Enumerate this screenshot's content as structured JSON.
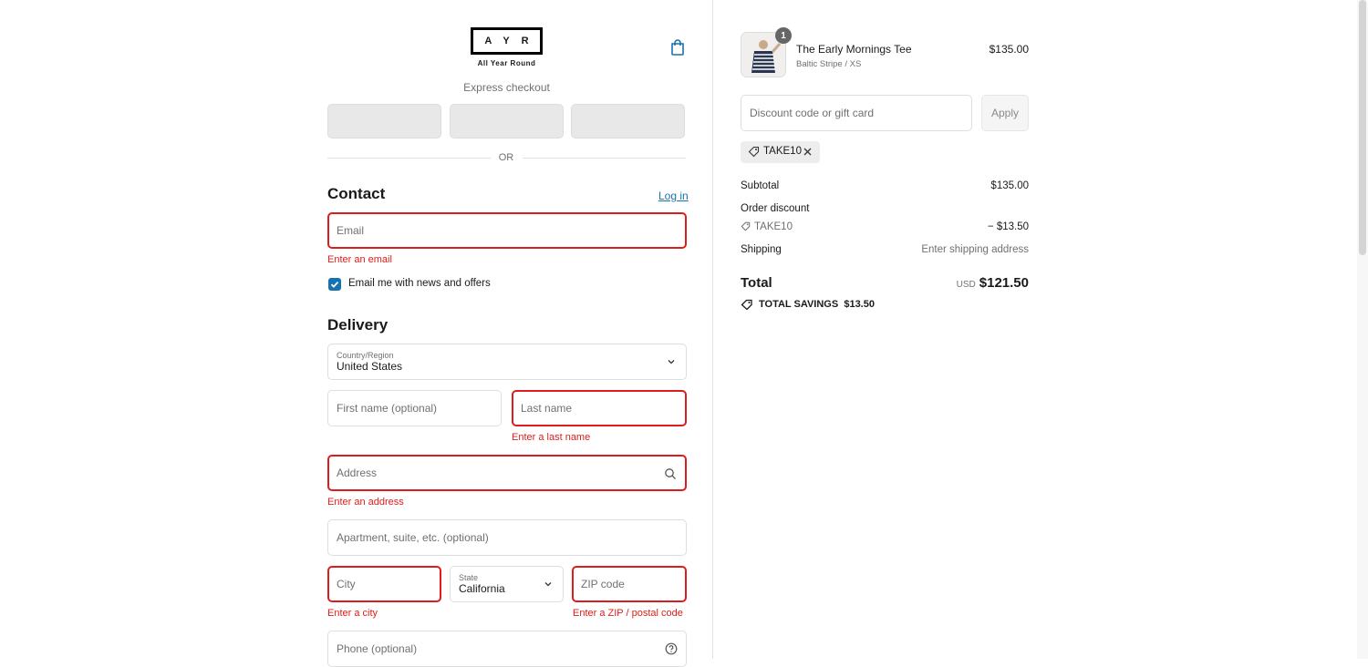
{
  "brand": {
    "logo_text": "AYR",
    "tagline": "All Year Round"
  },
  "express": {
    "label": "Express checkout",
    "or": "OR"
  },
  "contact": {
    "title": "Contact",
    "login": "Log in",
    "email_placeholder": "Email",
    "email_error": "Enter an email",
    "newsletter_label": "Email me with news and offers",
    "newsletter_checked": true
  },
  "delivery": {
    "title": "Delivery",
    "country_label": "Country/Region",
    "country_value": "United States",
    "first_name_placeholder": "First name (optional)",
    "last_name_placeholder": "Last name",
    "last_name_error": "Enter a last name",
    "address_placeholder": "Address",
    "address_error": "Enter an address",
    "apartment_placeholder": "Apartment, suite, etc. (optional)",
    "city_placeholder": "City",
    "city_error": "Enter a city",
    "state_label": "State",
    "state_value": "California",
    "zip_placeholder": "ZIP code",
    "zip_error": "Enter a ZIP / postal code",
    "phone_placeholder": "Phone (optional)"
  },
  "summary": {
    "product": {
      "name": "The Early Mornings Tee",
      "variant": "Baltic Stripe / XS",
      "price": "$135.00",
      "quantity": "1"
    },
    "discount_placeholder": "Discount code or gift card",
    "apply_label": "Apply",
    "applied_code": "TAKE10",
    "subtotal_label": "Subtotal",
    "subtotal_value": "$135.00",
    "order_discount_label": "Order discount",
    "discount_code": "TAKE10",
    "discount_value": "− $13.50",
    "shipping_label": "Shipping",
    "shipping_value": "Enter shipping address",
    "total_label": "Total",
    "currency": "USD",
    "total_value": "$121.50",
    "savings_label": "TOTAL SAVINGS",
    "savings_value": "$13.50"
  },
  "colors": {
    "accent": "#1773b0",
    "error": "#dd1d1d"
  }
}
